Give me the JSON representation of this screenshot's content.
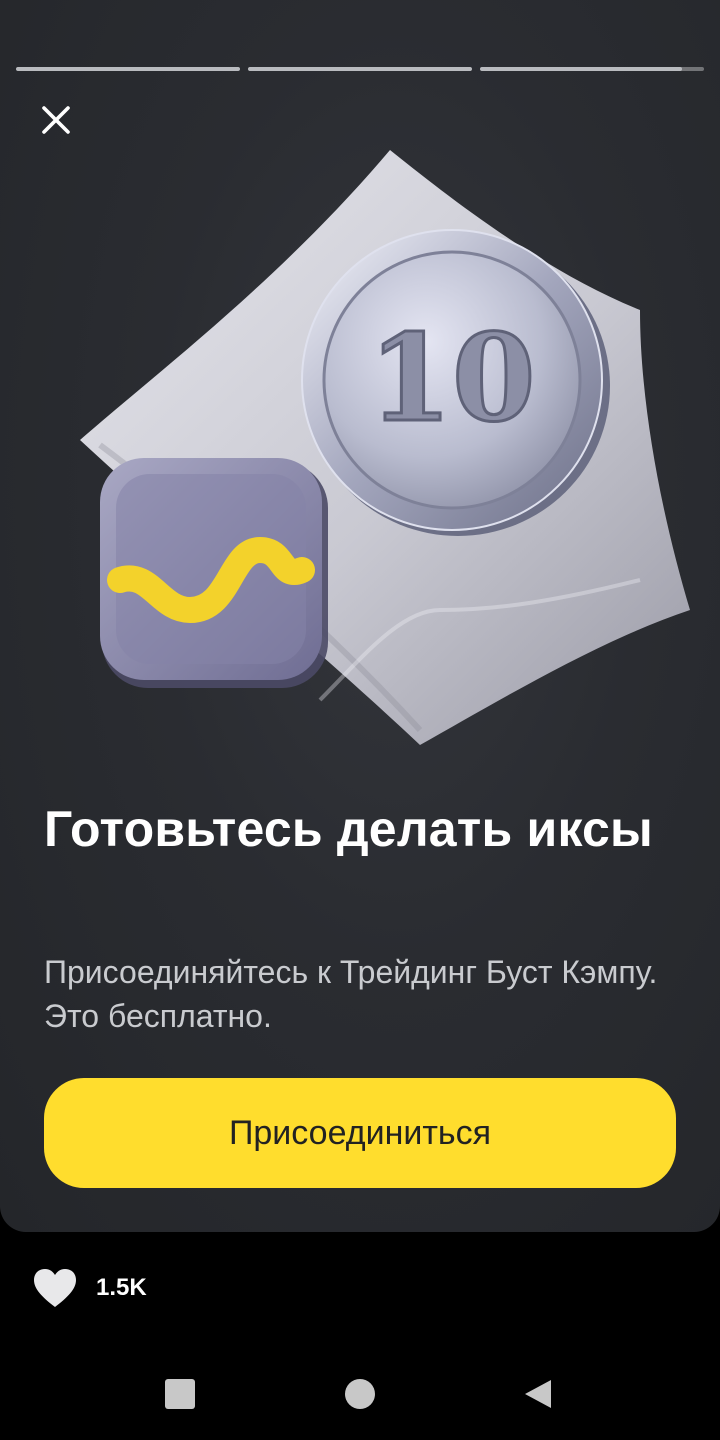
{
  "story": {
    "progress": [
      1,
      1,
      0.9
    ],
    "close_icon": "close-icon",
    "illustration": {
      "coin_label": "10",
      "subject": "silver-coin-on-pillow-with-chart-app-icon"
    },
    "headline": "Готовьтесь делать иксы",
    "description": "Присоединяйтесь к Трейдинг Буст Кэмпу. Это бесплатно.",
    "cta_label": "Присоединиться"
  },
  "likes": {
    "icon": "heart-icon",
    "count": "1.5K"
  },
  "navbar": {
    "items": [
      "recents-square-icon",
      "home-circle-icon",
      "back-triangle-icon"
    ]
  },
  "colors": {
    "accent": "#ffdd2d",
    "card_background": "#2a2c31",
    "page_background": "#000000",
    "text_primary": "#ffffff",
    "text_secondary": "#c9cbcf"
  }
}
